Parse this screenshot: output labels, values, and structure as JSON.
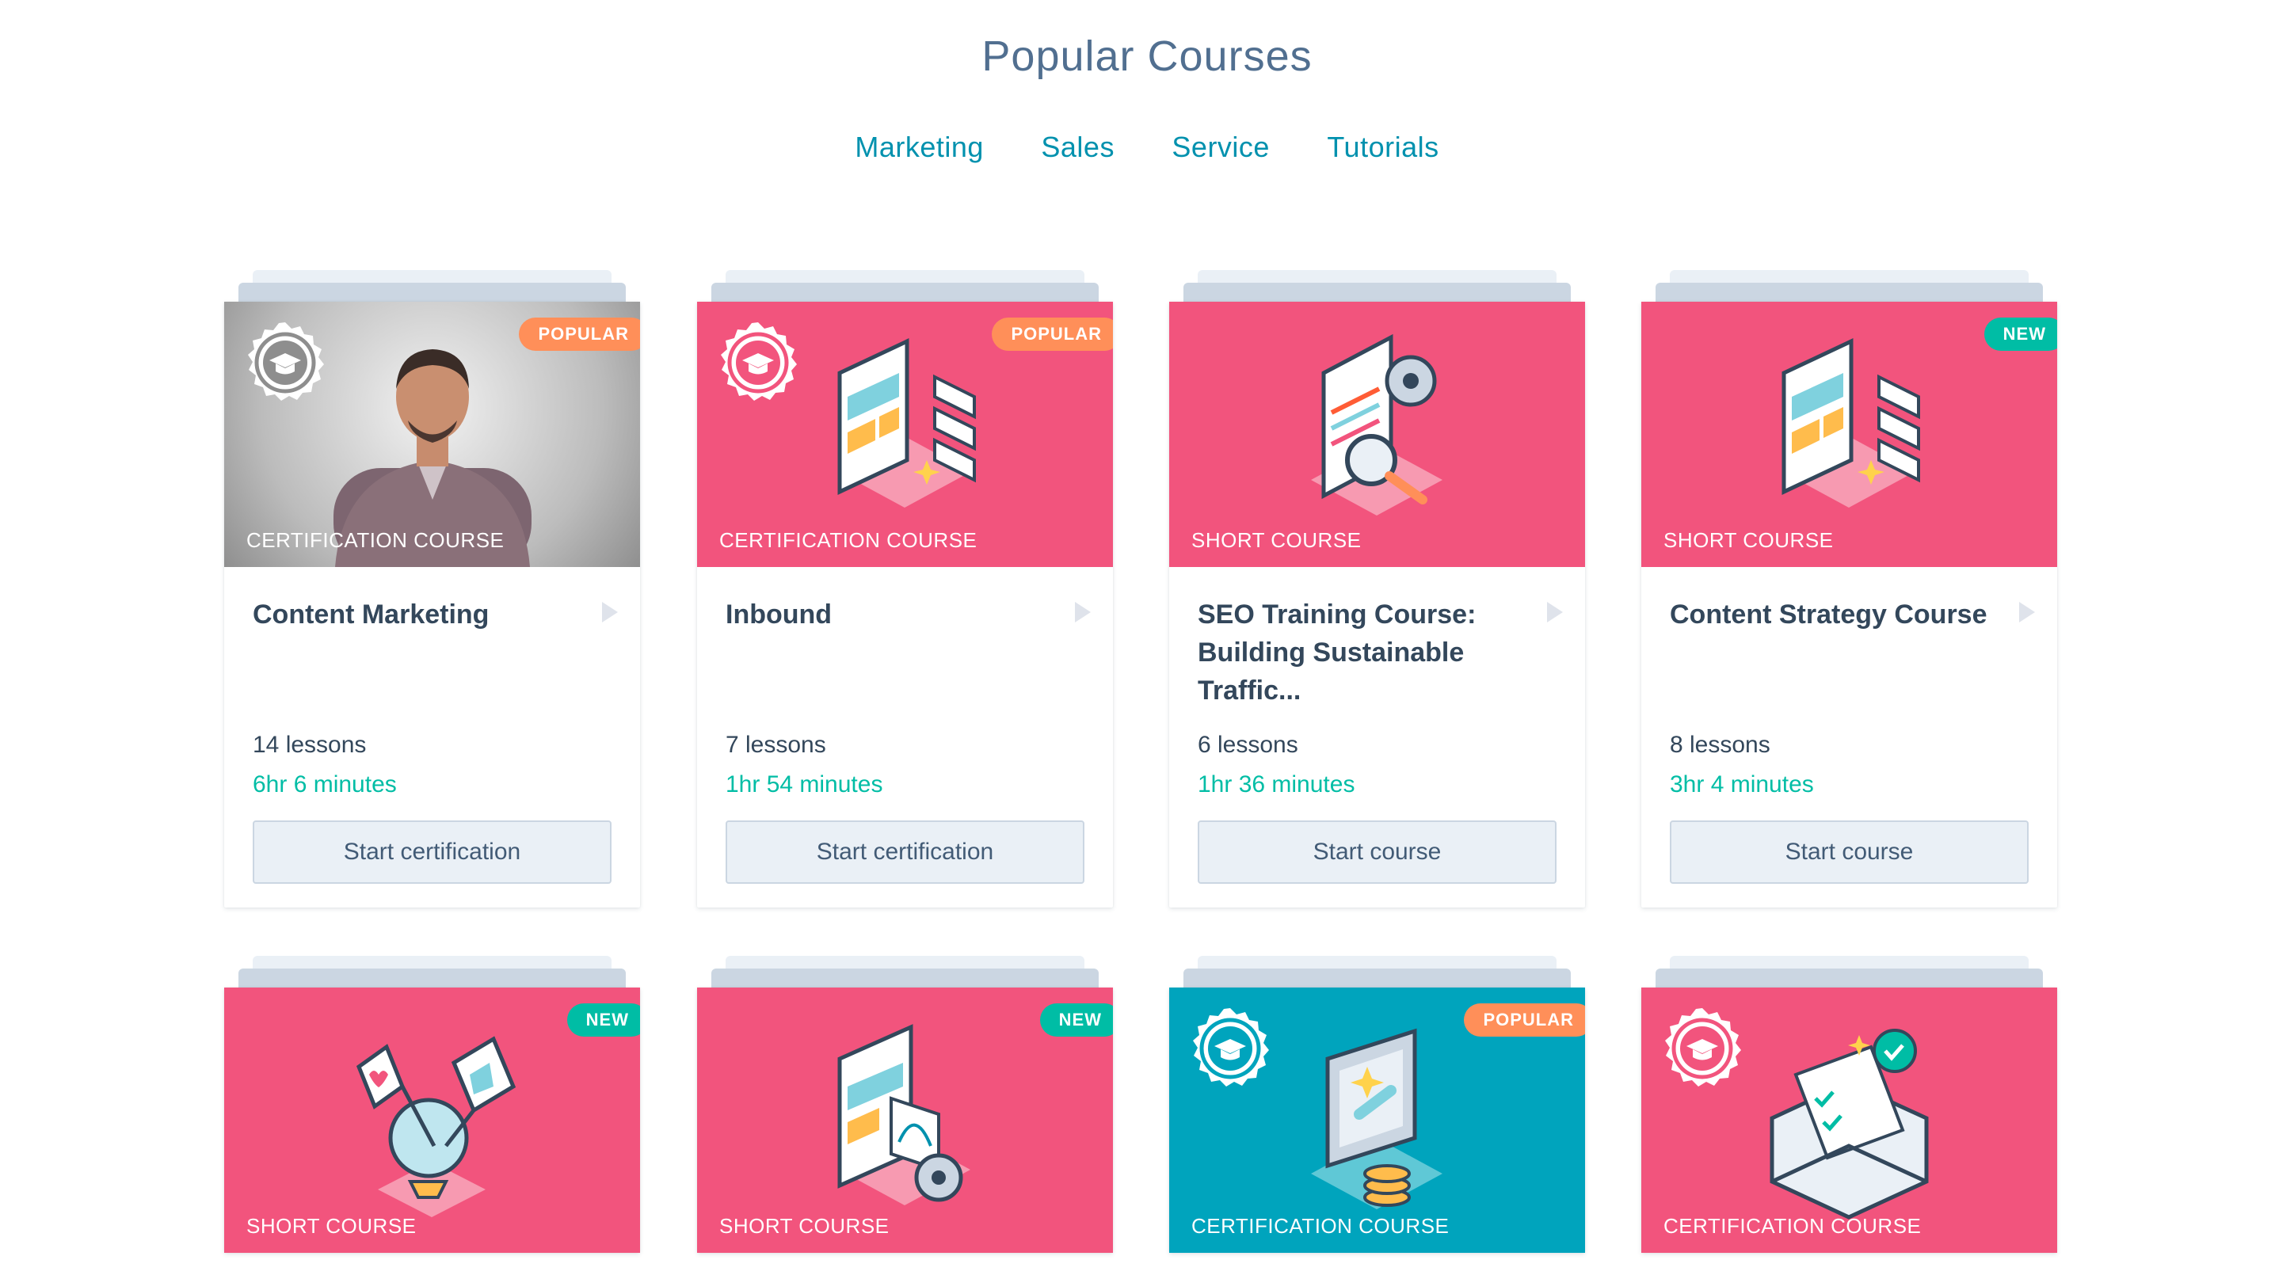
{
  "header": {
    "title": "Popular Courses",
    "tabs": [
      "Marketing",
      "Sales",
      "Service",
      "Tutorials"
    ]
  },
  "colors": {
    "pink": "#f2547d",
    "teal": "#00a4bd",
    "popular_badge": "#ff8f59",
    "new_badge": "#00bda5",
    "link": "#0091ae"
  },
  "courses": [
    {
      "type": "CERTIFICATION COURSE",
      "badge": "POPULAR",
      "title": "Content Marketing",
      "lessons": "14 lessons",
      "duration": "6hr 6 minutes",
      "cta": "Start certification",
      "hero": "photo",
      "icon": "instructor-photo"
    },
    {
      "type": "CERTIFICATION COURSE",
      "badge": "POPULAR",
      "title": "Inbound",
      "lessons": "7 lessons",
      "duration": "1hr 54 minutes",
      "cta": "Start certification",
      "hero": "pink",
      "icon": "dashboard-illustration-icon"
    },
    {
      "type": "SHORT COURSE",
      "badge": "",
      "title": "SEO Training Course: Building Sustainable Traffic...",
      "lessons": "6 lessons",
      "duration": "1hr 36 minutes",
      "cta": "Start course",
      "hero": "pink",
      "icon": "seo-magnifier-illustration-icon"
    },
    {
      "type": "SHORT COURSE",
      "badge": "NEW",
      "title": "Content Strategy Course",
      "lessons": "8 lessons",
      "duration": "3hr 4 minutes",
      "cta": "Start course",
      "hero": "pink",
      "icon": "dashboard-illustration-icon"
    },
    {
      "type": "SHORT COURSE",
      "badge": "NEW",
      "hero": "pink",
      "icon": "globe-flags-illustration-icon"
    },
    {
      "type": "SHORT COURSE",
      "badge": "NEW",
      "hero": "pink",
      "icon": "screen-gear-illustration-icon"
    },
    {
      "type": "CERTIFICATION COURSE",
      "badge": "POPULAR",
      "hero": "teal",
      "icon": "monitor-coins-illustration-icon"
    },
    {
      "type": "CERTIFICATION COURSE",
      "badge": "",
      "hero": "pink",
      "icon": "envelope-check-illustration-icon"
    }
  ]
}
